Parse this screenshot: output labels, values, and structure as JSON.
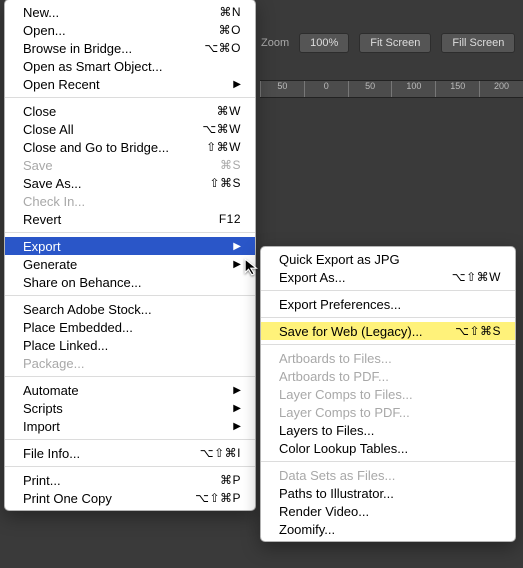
{
  "toolbar": {
    "zoom_label": "Zoom",
    "btn_100": "100%",
    "btn_fit": "Fit Screen",
    "btn_fill": "Fill Screen"
  },
  "ruler": [
    "50",
    "0",
    "50",
    "100",
    "150",
    "200"
  ],
  "file_menu": [
    {
      "t": "item",
      "label": "New...",
      "shortcut": "⌘N"
    },
    {
      "t": "item",
      "label": "Open...",
      "shortcut": "⌘O"
    },
    {
      "t": "item",
      "label": "Browse in Bridge...",
      "shortcut": "⌥⌘O"
    },
    {
      "t": "item",
      "label": "Open as Smart Object..."
    },
    {
      "t": "item",
      "label": "Open Recent",
      "submenu": true
    },
    {
      "t": "sep"
    },
    {
      "t": "item",
      "label": "Close",
      "shortcut": "⌘W"
    },
    {
      "t": "item",
      "label": "Close All",
      "shortcut": "⌥⌘W"
    },
    {
      "t": "item",
      "label": "Close and Go to Bridge...",
      "shortcut": "⇧⌘W"
    },
    {
      "t": "item",
      "label": "Save",
      "shortcut": "⌘S",
      "disabled": true
    },
    {
      "t": "item",
      "label": "Save As...",
      "shortcut": "⇧⌘S"
    },
    {
      "t": "item",
      "label": "Check In...",
      "disabled": true
    },
    {
      "t": "item",
      "label": "Revert",
      "shortcut": "F12"
    },
    {
      "t": "sep"
    },
    {
      "t": "item",
      "label": "Export",
      "submenu": true,
      "selected": true
    },
    {
      "t": "item",
      "label": "Generate",
      "submenu": true
    },
    {
      "t": "item",
      "label": "Share on Behance..."
    },
    {
      "t": "sep"
    },
    {
      "t": "item",
      "label": "Search Adobe Stock..."
    },
    {
      "t": "item",
      "label": "Place Embedded..."
    },
    {
      "t": "item",
      "label": "Place Linked..."
    },
    {
      "t": "item",
      "label": "Package...",
      "disabled": true
    },
    {
      "t": "sep"
    },
    {
      "t": "item",
      "label": "Automate",
      "submenu": true
    },
    {
      "t": "item",
      "label": "Scripts",
      "submenu": true
    },
    {
      "t": "item",
      "label": "Import",
      "submenu": true
    },
    {
      "t": "sep"
    },
    {
      "t": "item",
      "label": "File Info...",
      "shortcut": "⌥⇧⌘I"
    },
    {
      "t": "sep"
    },
    {
      "t": "item",
      "label": "Print...",
      "shortcut": "⌘P"
    },
    {
      "t": "item",
      "label": "Print One Copy",
      "shortcut": "⌥⇧⌘P"
    }
  ],
  "export_menu": [
    {
      "t": "item",
      "label": "Quick Export as JPG"
    },
    {
      "t": "item",
      "label": "Export As...",
      "shortcut": "⌥⇧⌘W"
    },
    {
      "t": "sep"
    },
    {
      "t": "item",
      "label": "Export Preferences..."
    },
    {
      "t": "sep"
    },
    {
      "t": "item",
      "label": "Save for Web (Legacy)...",
      "shortcut": "⌥⇧⌘S",
      "highlight": true
    },
    {
      "t": "sep"
    },
    {
      "t": "item",
      "label": "Artboards to Files...",
      "disabled": true
    },
    {
      "t": "item",
      "label": "Artboards to PDF...",
      "disabled": true
    },
    {
      "t": "item",
      "label": "Layer Comps to Files...",
      "disabled": true
    },
    {
      "t": "item",
      "label": "Layer Comps to PDF...",
      "disabled": true
    },
    {
      "t": "item",
      "label": "Layers to Files..."
    },
    {
      "t": "item",
      "label": "Color Lookup Tables..."
    },
    {
      "t": "sep"
    },
    {
      "t": "item",
      "label": "Data Sets as Files...",
      "disabled": true
    },
    {
      "t": "item",
      "label": "Paths to Illustrator..."
    },
    {
      "t": "item",
      "label": "Render Video..."
    },
    {
      "t": "item",
      "label": "Zoomify..."
    }
  ]
}
